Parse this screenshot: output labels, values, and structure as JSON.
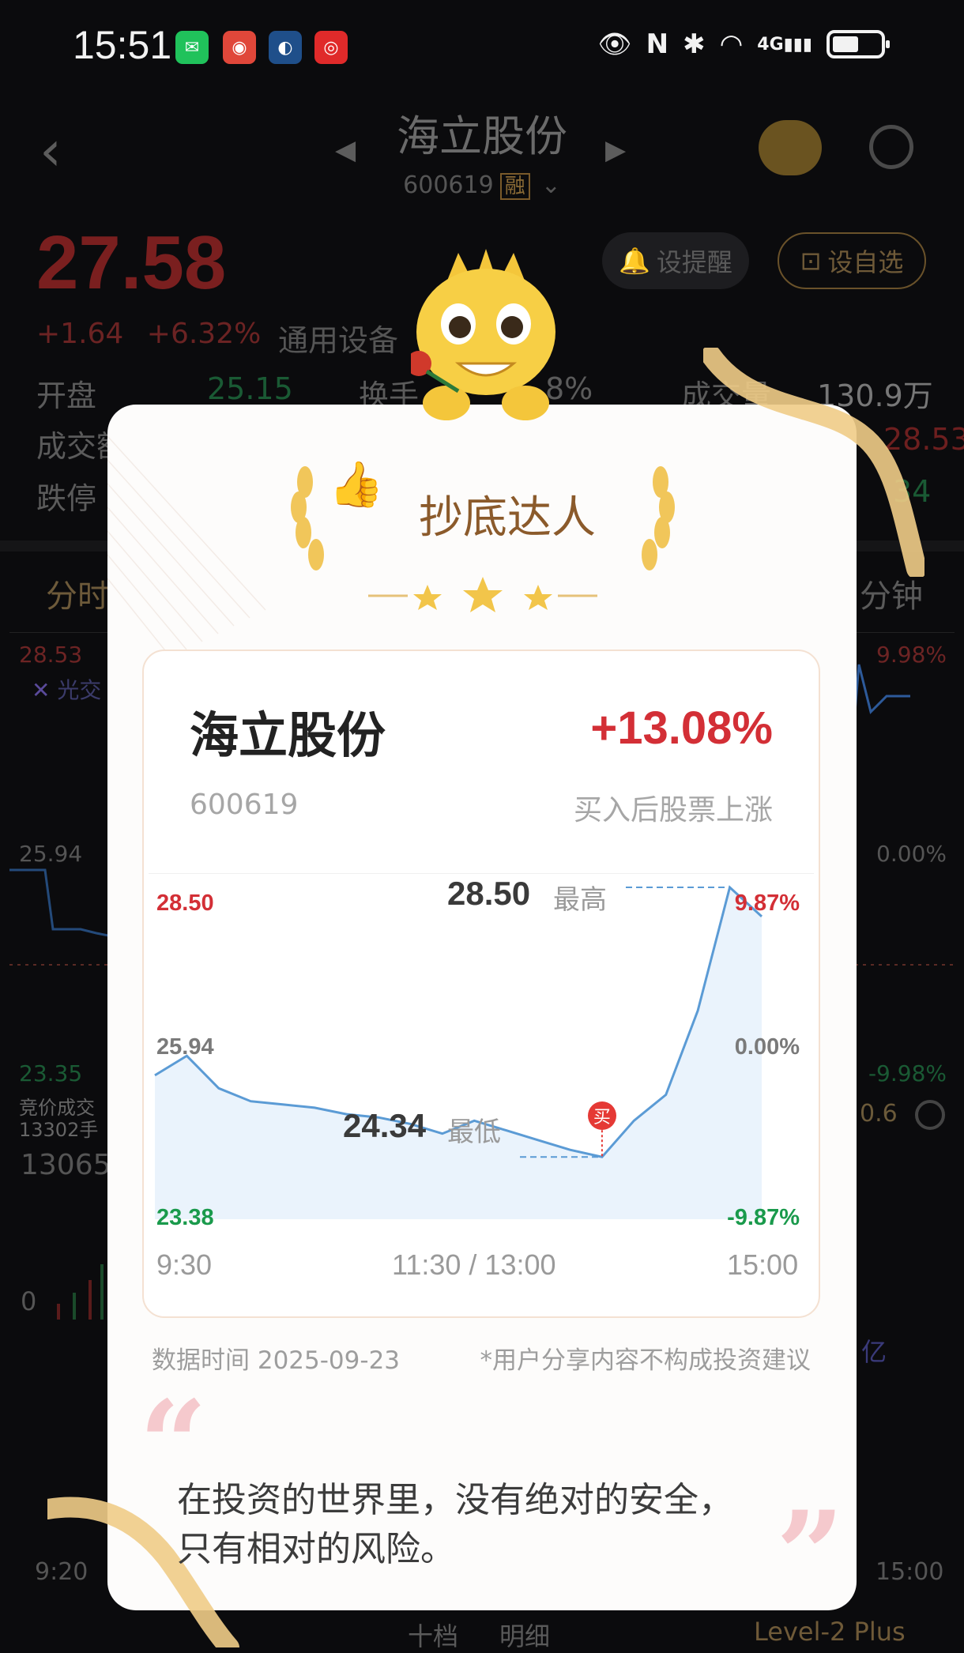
{
  "status_bar": {
    "time": "15:51",
    "network": "4G",
    "icons": [
      "wechat-icon",
      "app-icon",
      "app-icon",
      "app-icon",
      "eye-icon",
      "nfc-icon",
      "bluetooth-icon",
      "wifi-icon",
      "signal-icon",
      "battery-icon"
    ]
  },
  "header": {
    "title": "海立股份",
    "code": "600619",
    "tag": "融"
  },
  "quote": {
    "price": "27.58",
    "change": "+1.64",
    "change_pct": "+6.32%",
    "industry": "通用设备",
    "remind_label": "设提醒",
    "watch_label": "设自选",
    "open_label": "开盘",
    "open_value": "25.15",
    "turnover_label": "换手",
    "turnover_value": "8%",
    "volume_label": "成交量",
    "volume_value": "130.9万",
    "row2_label": "成交额",
    "row2_right": "28.53",
    "row3_label": "跌停",
    "row3_right": "34"
  },
  "chart_tabs": {
    "first": "分时",
    "last": "分钟"
  },
  "bg_chart": {
    "high": "28.53",
    "legend": "光交",
    "pct_high": "9.98%",
    "mid": "25.94",
    "pct_mid": "0.00%",
    "low": "23.35",
    "pct_low": "-9.98%",
    "auction_label": "竞价成交",
    "auction_value": "13302手",
    "vol_value": "13065",
    "vol_zero": "0",
    "right_val": "0.6",
    "right_unit": "亿",
    "t_start": "9:20",
    "t_end": "15:00"
  },
  "bottom_bar": {
    "tab1": "十档",
    "tab2": "明细",
    "level2": "Level-2 Plus"
  },
  "card": {
    "award": "抄底达人",
    "stock_name": "海立股份",
    "stock_code": "600619",
    "gain_pct": "+13.08%",
    "gain_note": "买入后股票上涨",
    "high_value": "28.50",
    "high_label": "最高",
    "low_value": "24.34",
    "low_label": "最低",
    "buy_marker": "买",
    "y_top": "28.50",
    "y_mid": "25.94",
    "y_bot": "23.38",
    "pct_top": "9.87%",
    "pct_mid": "0.00%",
    "pct_bot": "-9.87%",
    "t_start": "9:30",
    "t_mid": "11:30 / 13:00",
    "t_end": "15:00",
    "data_time": "数据时间 2025-09-23",
    "disclaimer": "*用户分享内容不构成投资建议",
    "quote_line1": "在投资的世界里，没有绝对的安全，",
    "quote_line2": "只有相对的风险。"
  },
  "chart_data": {
    "type": "area",
    "x": [
      "9:30",
      "9:45",
      "10:00",
      "10:15",
      "10:30",
      "10:45",
      "11:00",
      "11:15",
      "11:30",
      "13:15",
      "13:30",
      "13:45",
      "14:00",
      "14:15",
      "14:30",
      "14:35",
      "14:40",
      "14:45",
      "14:50",
      "15:00"
    ],
    "series": [
      {
        "values": [
          25.6,
          25.9,
          25.4,
          25.2,
          25.15,
          25.1,
          25.0,
          24.95,
          24.85,
          24.7,
          24.9,
          24.75,
          24.6,
          24.45,
          24.34,
          24.9,
          25.3,
          26.6,
          28.5,
          28.05
        ]
      }
    ],
    "ylim": [
      23.38,
      28.5
    ],
    "buy_point": {
      "x": "14:30",
      "y": 24.34
    },
    "colors": {
      "line": "#5b9bd5",
      "fill": "#eaf3fc",
      "up": "#d32f36",
      "down": "#1a9a4c"
    }
  }
}
